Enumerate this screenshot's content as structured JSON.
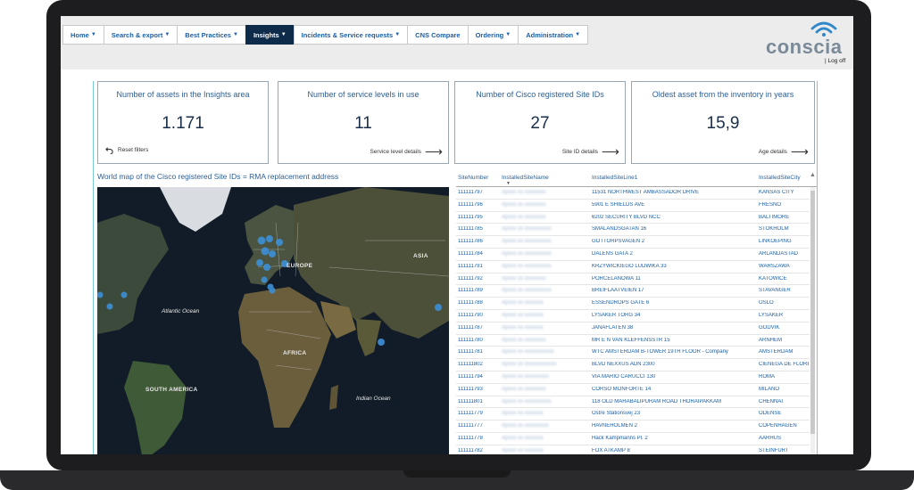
{
  "nav": {
    "items": [
      {
        "label": "Home",
        "dropdown": true,
        "active": false
      },
      {
        "label": "Search & export",
        "dropdown": true,
        "active": false
      },
      {
        "label": "Best Practices",
        "dropdown": true,
        "active": false
      },
      {
        "label": "Insights",
        "dropdown": true,
        "active": true
      },
      {
        "label": "Incidents & Service requests",
        "dropdown": true,
        "active": false
      },
      {
        "label": "CNS Compare",
        "dropdown": false,
        "active": false
      },
      {
        "label": "Ordering",
        "dropdown": true,
        "active": false
      },
      {
        "label": "Administration",
        "dropdown": true,
        "active": false
      }
    ],
    "caret": "▼"
  },
  "brand": {
    "name": "conscia",
    "color": "#7b8a99"
  },
  "header": {
    "logoff_label": "| Log off"
  },
  "kpis": [
    {
      "title": "Number of assets in the Insights area",
      "value": "1.171",
      "action": "Reset filters",
      "action_icon": "undo-icon"
    },
    {
      "title": "Number of service levels in use",
      "value": "11",
      "action": "Service level details",
      "action_icon": "arrow-right-icon"
    },
    {
      "title": "Number of Cisco registered Site IDs",
      "value": "27",
      "action": "Site ID details",
      "action_icon": "arrow-right-icon"
    },
    {
      "title": "Oldest asset from the inventory in years",
      "value": "15,9",
      "action": "Age details",
      "action_icon": "arrow-right-icon"
    }
  ],
  "map": {
    "title": "World map of the Cisco registered Site IDs = RMA replacement address",
    "labels": {
      "atlantic": "Atlantic Ocean",
      "indian": "Indian Ocean",
      "europe": "EUROPE",
      "asia": "ASIA",
      "africa": "AFRICA",
      "south_america": "SOUTH AMERICA"
    },
    "marker_color": "#3d8fd6"
  },
  "table": {
    "columns": [
      "SiteNumber",
      "InstalledSiteName",
      "InstalledSiteLine1",
      "InstalledSiteCity"
    ],
    "rows": [
      {
        "site": "111111797",
        "name": "Apxxx xx xxxxxxxx",
        "line1": "11531 NORTHWEST AMBASSADOR DRIVE",
        "city": "KANSAS CITY"
      },
      {
        "site": "111111796",
        "name": "Apxxx xx xxxxxxxx",
        "line1": "5901 E SHIELDS AVE",
        "city": "FRESNO"
      },
      {
        "site": "111111795",
        "name": "Apxxx xx xxxxxxxx",
        "line1": "6202 SECURITY BLVD NCC",
        "city": "BALTIMORE"
      },
      {
        "site": "111111785",
        "name": "Apxxx xx xxxxxxxxxx",
        "line1": "SMALANDSGATAN 16",
        "city": "STOKHOLM"
      },
      {
        "site": "111111786",
        "name": "Apxxx xx xxxxxxxxxx",
        "line1": "GOTTORPSVAGEN 2",
        "city": "LINKOEPING"
      },
      {
        "site": "111111784",
        "name": "Apxxx xx xxxxxxxxxx",
        "line1": "DALENS GATA 2",
        "city": "ARLANDASTAD"
      },
      {
        "site": "111111791",
        "name": "Apxxx xx xxxxxxxxxx",
        "line1": "KRZYWICKIEGO LUDWIKA 33",
        "city": "WARSZAWA"
      },
      {
        "site": "111111792",
        "name": "Apxxx xx xxxxxxxx",
        "line1": "PORCELANOWA 11",
        "city": "KATOWICE"
      },
      {
        "site": "111111789",
        "name": "Apxxx xx xxxxxxxxxx",
        "line1": "BREIFLAATVEIEN 17",
        "city": "STAVANGER"
      },
      {
        "site": "111111788",
        "name": "Apxxx xx xxxxxxx",
        "line1": "ESSENDROPS GATE 6",
        "city": "OSLO"
      },
      {
        "site": "111111790",
        "name": "Apxxx xx xxxxxxx",
        "line1": "LYSAKER TORG 34",
        "city": "LYSAKER"
      },
      {
        "site": "111111787",
        "name": "Apxxx xx xxxxxxx",
        "line1": "JANAFLATEN 38",
        "city": "GODVIK"
      },
      {
        "site": "111111780",
        "name": "Apxxx xx xxxxxxxx",
        "line1": "MR E N VAN KLEFFENSSTR 15",
        "city": "ARNHEM"
      },
      {
        "site": "111111781",
        "name": "Apxxx xx xxxxxxxxxxx",
        "line1": "WTC AMSTERDAM B-TOWER 19TH FLOOR - Company",
        "city": "AMSTERDAM"
      },
      {
        "site": "111111802",
        "name": "Apxxx xx xxxxxxxxxxxx",
        "line1": "BLVD NEXXUS ADN 2300",
        "city": "CIENEGA DE FLORES"
      },
      {
        "site": "111111794",
        "name": "Apxxx xx xxxxxxxxx",
        "line1": "VIA MARIO CARUCCI 130",
        "city": "ROMA"
      },
      {
        "site": "111111793",
        "name": "Apxxx xx xxxxxxxx",
        "line1": "CORSO MONFORTE 14",
        "city": "MILANO"
      },
      {
        "site": "111111801",
        "name": "Apxxx xx xxxxxxxxxx",
        "line1": "118 OLD MAHABALIPURAM ROAD THORAIPAKKAM",
        "city": "CHENNAI"
      },
      {
        "site": "111111779",
        "name": "Apxxx xx xxxxxxx",
        "line1": "Ostre Stationsvej 23",
        "city": "ODENSE"
      },
      {
        "site": "111111777",
        "name": "Apxxx xx xxxxxxxxx",
        "line1": "HAVNEHOLMEN 2",
        "city": "COPENHAGEN"
      },
      {
        "site": "111111778",
        "name": "Apxxx xx xxxxxxx",
        "line1": "Hack Kampmanns Pl. 2",
        "city": "AARHUS"
      },
      {
        "site": "111111782",
        "name": "Apxxx xx xxxxxxx",
        "line1": "FOX ATKAMP 8",
        "city": "STEINFURT"
      }
    ]
  }
}
